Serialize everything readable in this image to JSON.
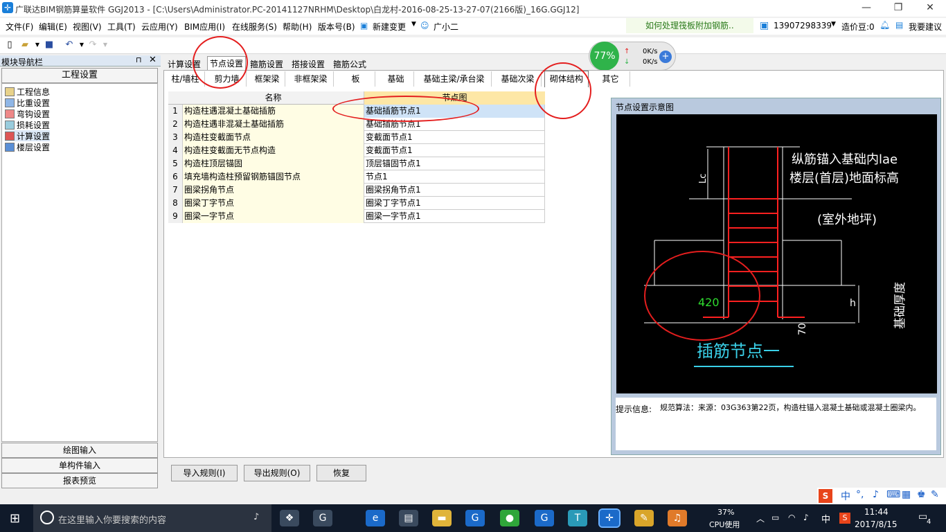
{
  "window": {
    "title": "广联达BIM钢筋算量软件 GGJ2013 - [C:\\Users\\Administrator.PC-20141127NRHM\\Desktop\\白龙村-2016-08-25-13-27-07(2166版)_16G.GGJ12]"
  },
  "menu": [
    "文件(F)",
    "编辑(E)",
    "视图(V)",
    "工具(T)",
    "云应用(Y)",
    "BIM应用(I)",
    "在线服务(S)",
    "帮助(H)",
    "版本号(B)",
    "新建变更",
    "广小二"
  ],
  "tip": "如何处理筏板附加钢筋..",
  "account": {
    "phone": "13907298339",
    "coins": "造价豆:0",
    "suggest": "我要建议"
  },
  "speed": {
    "percent": "77%",
    "up": "0K/s",
    "down": "0K/s"
  },
  "nav": {
    "header": "模块导航栏",
    "group": "工程设置",
    "items": [
      "工程信息",
      "比重设置",
      "弯钩设置",
      "损耗设置",
      "计算设置",
      "楼层设置"
    ],
    "bottom": [
      "绘图输入",
      "单构件输入",
      "报表预览"
    ]
  },
  "tabs1": [
    "计算设置",
    "节点设置",
    "箍筋设置",
    "搭接设置",
    "箍筋公式"
  ],
  "tabs2": [
    "柱/墙柱",
    "剪力墙",
    "框架梁",
    "非框架梁",
    "板",
    "基础",
    "基础主梁/承台梁",
    "基础次梁",
    "砌体结构",
    "其它"
  ],
  "grid": {
    "headers": [
      "名称",
      "节点图"
    ],
    "rows": [
      {
        "n": "1",
        "name": "构造柱遇混凝土基础插筋",
        "node": "基础插筋节点1"
      },
      {
        "n": "2",
        "name": "构造柱遇非混凝土基础插筋",
        "node": "基础插筋节点1"
      },
      {
        "n": "3",
        "name": "构造柱变截面节点",
        "node": "变截面节点1"
      },
      {
        "n": "4",
        "name": "构造柱变截面无节点构造",
        "node": "变截面节点1"
      },
      {
        "n": "5",
        "name": "构造柱顶层锚固",
        "node": "顶层锚固节点1"
      },
      {
        "n": "6",
        "name": "填充墙构造柱预留钢筋锚固节点",
        "node": "节点1"
      },
      {
        "n": "7",
        "name": "圈梁拐角节点",
        "node": "圈梁拐角节点1"
      },
      {
        "n": "8",
        "name": "圈梁丁字节点",
        "node": "圈梁丁字节点1"
      },
      {
        "n": "9",
        "name": "圈梁一字节点",
        "node": "圈梁一字节点1"
      }
    ]
  },
  "preview": {
    "title": "节点设置示意图",
    "label1": "纵筋锚入基础内lae",
    "label2": "楼层(首层)地面标高",
    "label3": "(室外地坪)",
    "lc": "Lc",
    "dim420": "420",
    "dimh": "h",
    "dim70": "70",
    "thick": "基础厚度",
    "caption": "插筋节点一"
  },
  "hint": {
    "label": "提示信息:",
    "text": "规范算法：来源：03G363第22页，构造柱锚入混凝土基础或混凝土圈梁内。"
  },
  "buttons": [
    "导入规则(I)",
    "导出规则(O)",
    "恢复"
  ],
  "taskbar": {
    "search": "在这里输入你要搜索的内容",
    "cpu": "37%",
    "cpu_label": "CPU使用",
    "time": "11:44",
    "date": "2017/8/15",
    "ime": "中",
    "notif": "4"
  },
  "colors": {
    "accent": "#1a7fd9",
    "annotation": "#e41e1e",
    "rebar": "#ff2020"
  }
}
